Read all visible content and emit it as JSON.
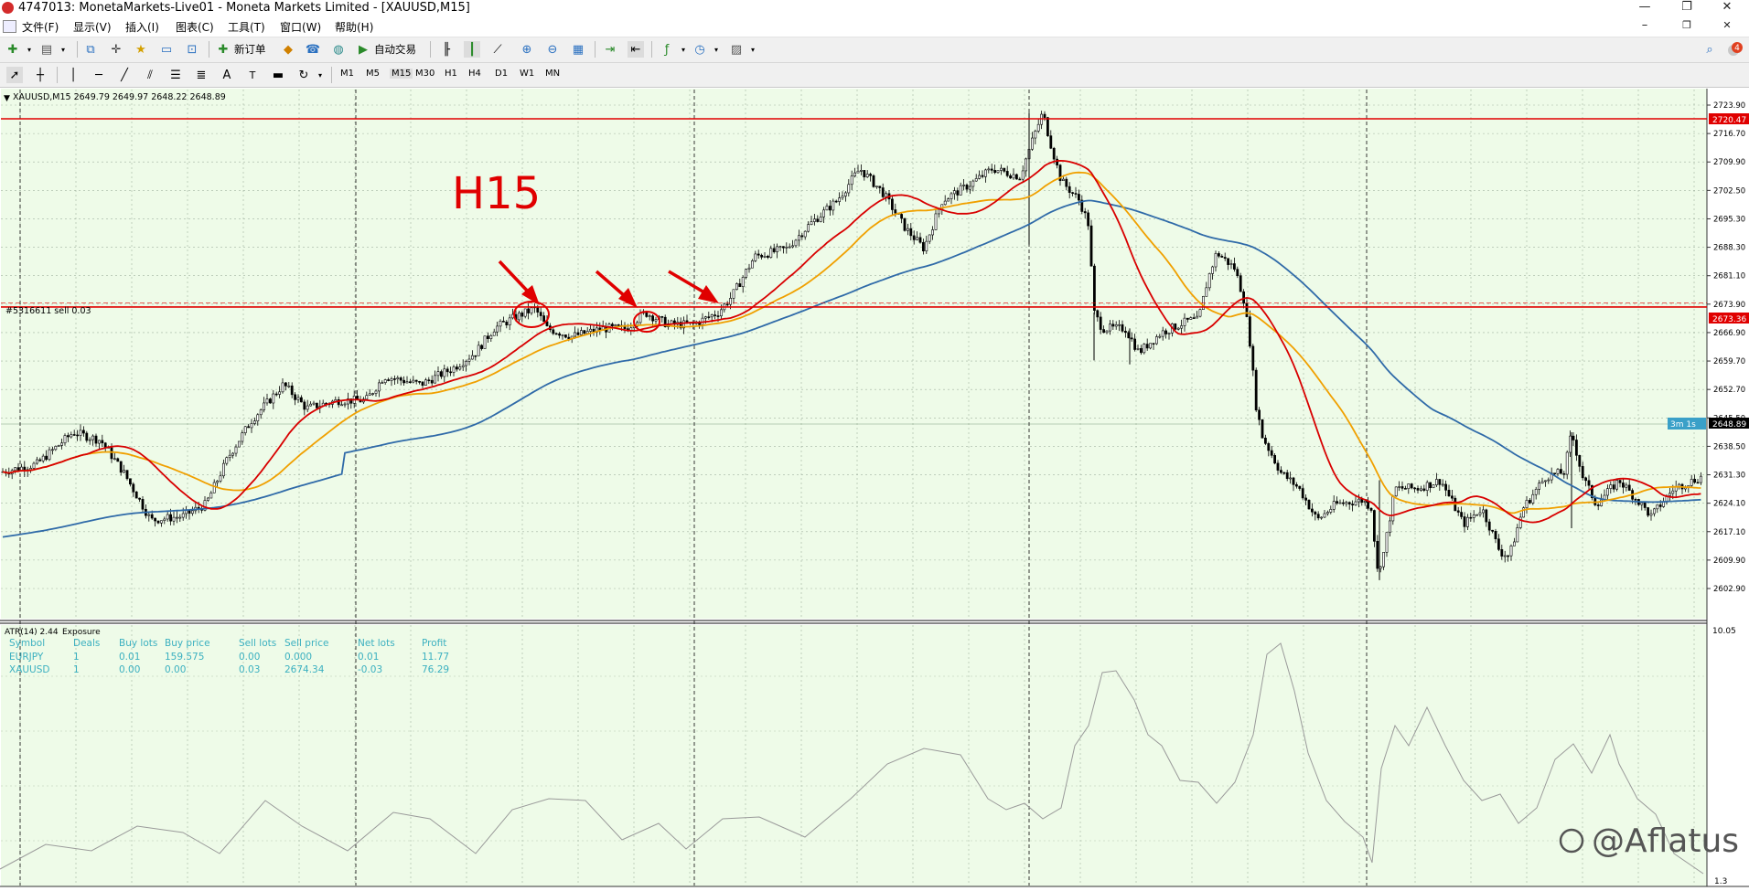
{
  "window": {
    "title": "4747013: MonetaMarkets-Live01 - Moneta Markets Limited - [XAUUSD,M15]",
    "controls": [
      "—",
      "❐",
      "✕"
    ]
  },
  "menu": [
    "文件(F)",
    "显示(V)",
    "插入(I)",
    "图表(C)",
    "工具(T)",
    "窗口(W)",
    "帮助(H)"
  ],
  "toolbar": {
    "new_order": "新订单",
    "auto_trading": "自动交易",
    "notification_count": "4"
  },
  "timeframes": [
    "M1",
    "M5",
    "M15",
    "M30",
    "H1",
    "H4",
    "D1",
    "W1",
    "MN"
  ],
  "colors": {
    "chart_bg": "#eefbe8",
    "grid": "#8fa18f",
    "candle": "#000000",
    "ma_fast": "#d80000",
    "ma_mid": "#f0a000",
    "ma_slow": "#2f6aa8",
    "level_line": "#e00000",
    "annotation": "#e00000",
    "panel_text": "#3bb0c0",
    "price_tag_bg": "#e00000",
    "timer_bg": "#3aa0c8"
  },
  "chart": {
    "symbol_info": "XAUUSD,M15  2649.79 2649.97 2648.22 2648.89",
    "annotation_text": "H15",
    "order_label": "#5316611 sell 0.03",
    "level_upper": "2720.47",
    "level_order": "2673.36",
    "current_price": "2648.89",
    "timer": "3m 1s",
    "price_axis": [
      "2723.90",
      "2716.70",
      "2709.90",
      "2702.50",
      "2695.30",
      "2688.30",
      "2681.10",
      "2673.90",
      "2666.90",
      "2659.70",
      "2652.70",
      "2645.50",
      "2638.50",
      "2631.30",
      "2624.10",
      "2617.10",
      "2609.90",
      "2602.90"
    ]
  },
  "indicator": {
    "label": "ATR(14) 2.44",
    "window_label": "Exposure",
    "axis_max": "10.05",
    "axis_min": "1.3",
    "exposure": {
      "headers": [
        "Symbol",
        "Deals",
        "Buy lots",
        "Buy price",
        "Sell lots",
        "Sell price",
        "Net lots",
        "Profit"
      ],
      "rows": [
        [
          "EURJPY",
          "1",
          "0.01",
          "159.575",
          "0.00",
          "0.000",
          "0.01",
          "11.77"
        ],
        [
          "XAUUSD",
          "1",
          "0.00",
          "0.00",
          "0.03",
          "2674.34",
          "-0.03",
          "76.29"
        ]
      ]
    }
  },
  "watermark": "@Aflatus"
}
